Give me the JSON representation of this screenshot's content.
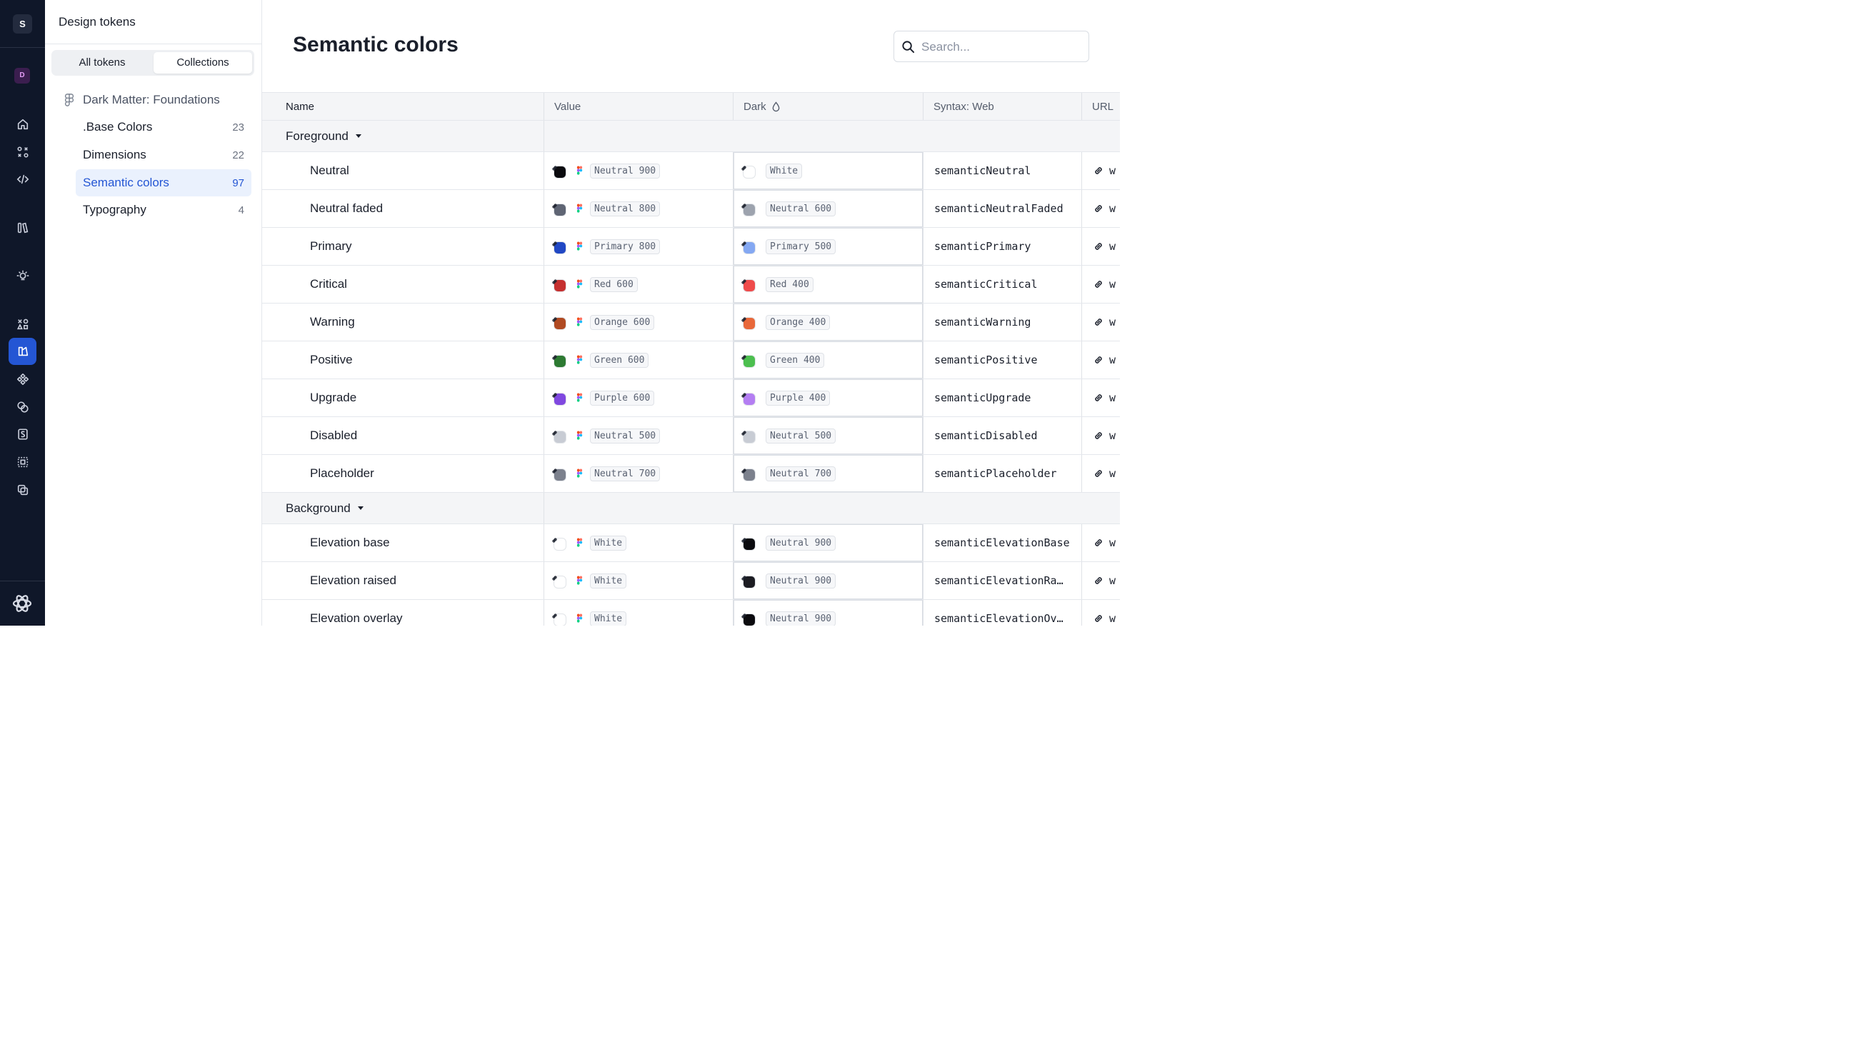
{
  "rail": {
    "workspace_initial": "S",
    "space_initial": "D"
  },
  "sidebar": {
    "title": "Design tokens",
    "segments": {
      "all": "All tokens",
      "collections": "Collections"
    },
    "collection": "Dark Matter: Foundations",
    "items": [
      {
        "label": ".Base Colors",
        "count": "23"
      },
      {
        "label": "Dimensions",
        "count": "22"
      },
      {
        "label": "Semantic colors",
        "count": "97"
      },
      {
        "label": "Typography",
        "count": "4"
      }
    ]
  },
  "main": {
    "title": "Semantic colors",
    "search_placeholder": "Search...",
    "columns": {
      "name": "Name",
      "value": "Value",
      "dark": "Dark",
      "syntax": "Syntax: Web",
      "url": "URL"
    },
    "groups": [
      {
        "name": "Foreground",
        "rows": [
          {
            "name": "Neutral",
            "value": "Neutral 900",
            "value_color": "#0b0b0f",
            "dark": "White",
            "dark_color": "#ffffff",
            "syntax": "semanticNeutral",
            "url": "w"
          },
          {
            "name": "Neutral faded",
            "value": "Neutral 800",
            "value_color": "#5f6574",
            "dark": "Neutral 600",
            "dark_color": "#9da3ae",
            "syntax": "semanticNeutralFaded",
            "url": "w"
          },
          {
            "name": "Primary",
            "value": "Primary 800",
            "value_color": "#2148c4",
            "dark": "Primary 500",
            "dark_color": "#84a8f2",
            "syntax": "semanticPrimary",
            "url": "w"
          },
          {
            "name": "Critical",
            "value": "Red 600",
            "value_color": "#c53030",
            "dark": "Red 400",
            "dark_color": "#ef4b4b",
            "syntax": "semanticCritical",
            "url": "w"
          },
          {
            "name": "Warning",
            "value": "Orange 600",
            "value_color": "#b04a22",
            "dark": "Orange 400",
            "dark_color": "#e8683a",
            "syntax": "semanticWarning",
            "url": "w"
          },
          {
            "name": "Positive",
            "value": "Green 600",
            "value_color": "#2d7a32",
            "dark": "Green 400",
            "dark_color": "#4cbf4f",
            "syntax": "semanticPositive",
            "url": "w"
          },
          {
            "name": "Upgrade",
            "value": "Purple 600",
            "value_color": "#8048e0",
            "dark": "Purple 400",
            "dark_color": "#b47ef2",
            "syntax": "semanticUpgrade",
            "url": "w"
          },
          {
            "name": "Disabled",
            "value": "Neutral 500",
            "value_color": "#c8ccd4",
            "dark": "Neutral 500",
            "dark_color": "#c8ccd4",
            "syntax": "semanticDisabled",
            "url": "w"
          },
          {
            "name": "Placeholder",
            "value": "Neutral 700",
            "value_color": "#7c818d",
            "dark": "Neutral 700",
            "dark_color": "#7c818d",
            "syntax": "semanticPlaceholder",
            "url": "w"
          }
        ]
      },
      {
        "name": "Background",
        "rows": [
          {
            "name": "Elevation base",
            "value": "White",
            "value_color": "#ffffff",
            "dark": "Neutral 900",
            "dark_color": "#0b0b0f",
            "syntax": "semanticElevationBase",
            "url": "w"
          },
          {
            "name": "Elevation raised",
            "value": "White",
            "value_color": "#ffffff",
            "dark": "Neutral 900",
            "dark_color": "#1c1c22",
            "syntax": "semanticElevationRa…",
            "url": "w"
          },
          {
            "name": "Elevation overlay",
            "value": "White",
            "value_color": "#ffffff",
            "dark": "Neutral 900",
            "dark_color": "#0b0b0f",
            "syntax": "semanticElevationOv…",
            "url": "w"
          }
        ]
      }
    ]
  }
}
